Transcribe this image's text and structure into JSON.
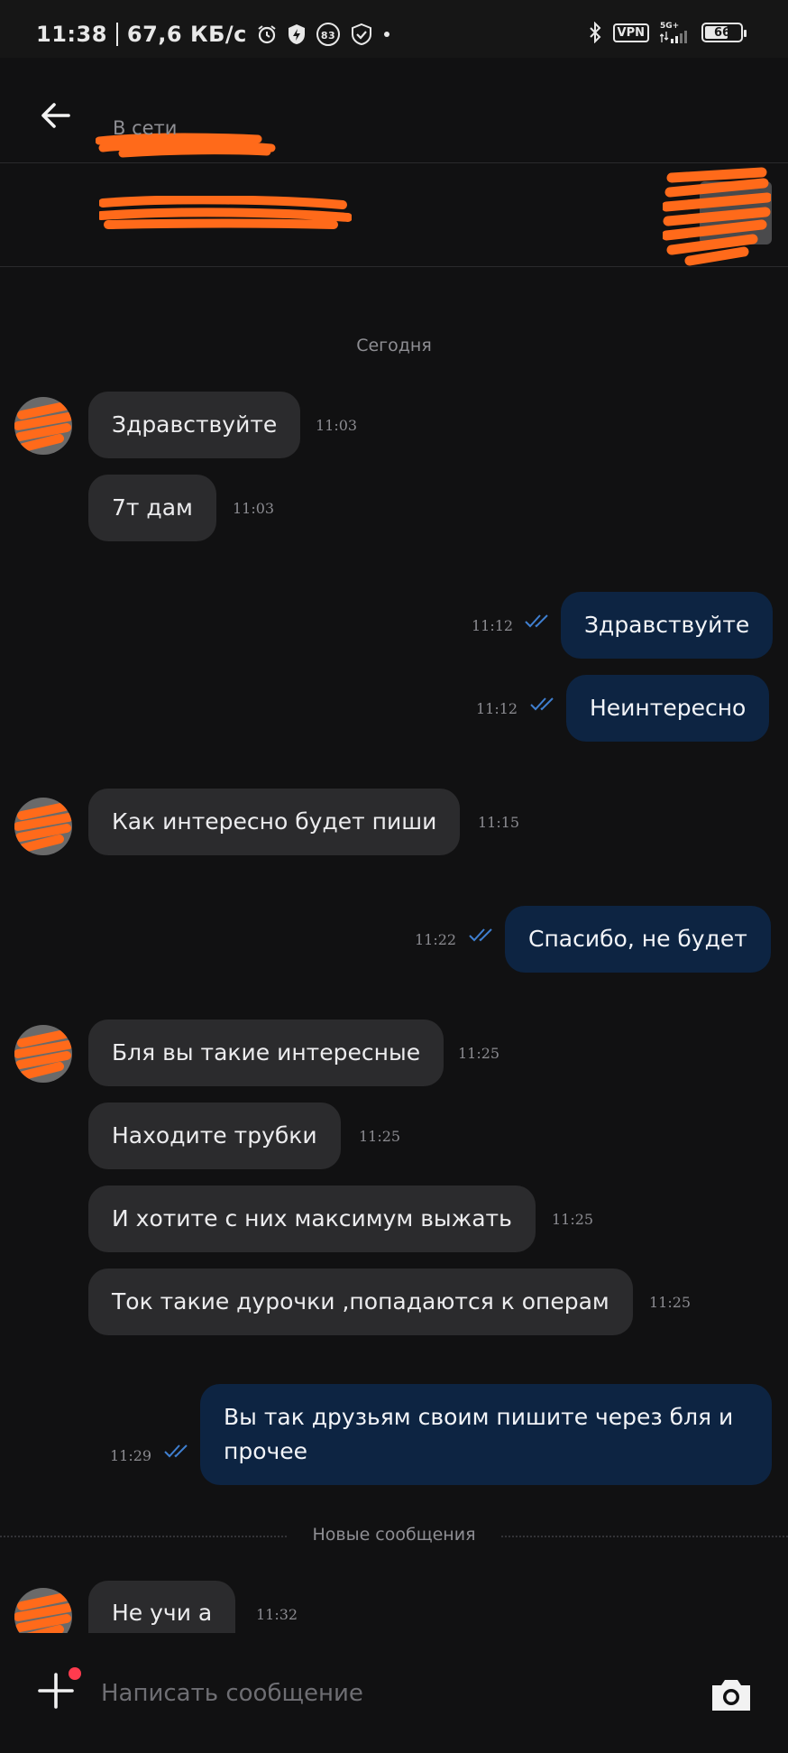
{
  "status_bar": {
    "time": "11:38",
    "net_speed": "67,6 КБ/с",
    "notif_badge": "83",
    "vpn": "VPN",
    "signal": "5G+",
    "battery": "66",
    "battery_level": 0.66
  },
  "header": {
    "status": "В сети"
  },
  "chat": {
    "day_label": "Сегодня",
    "new_messages_label": "Новые сообщения",
    "messages": [
      {
        "dir": "in",
        "text": "Здравствуйте",
        "time": "11:03"
      },
      {
        "dir": "in",
        "text": "7т дам",
        "time": "11:03"
      },
      {
        "dir": "out",
        "text": "Здравствуйте",
        "time": "11:12"
      },
      {
        "dir": "out",
        "text": "Неинтересно",
        "time": "11:12"
      },
      {
        "dir": "in",
        "text": "Как интересно будет пиши",
        "time": "11:15"
      },
      {
        "dir": "out",
        "text": "Спасибо, не будет",
        "time": "11:22"
      },
      {
        "dir": "in",
        "text": "Бля вы такие интересные",
        "time": "11:25"
      },
      {
        "dir": "in",
        "text": "Находите трубки",
        "time": "11:25"
      },
      {
        "dir": "in",
        "text": "И хотите с них максимум выжать",
        "time": "11:25"
      },
      {
        "dir": "in",
        "text": "Ток такие дурочки ,попадаются к операм",
        "time": "11:25"
      },
      {
        "dir": "out",
        "text": "Вы так друзьям своим пишите через бля и прочее",
        "time": "11:29"
      },
      {
        "dir": "in",
        "text": "Не учи а",
        "time": "11:32"
      }
    ]
  },
  "composer": {
    "placeholder": "Написать сообщение"
  },
  "colors": {
    "background": "#111112",
    "incoming_bubble": "#2b2b2d",
    "outgoing_bubble": "#0d2442",
    "read_check": "#3f7fd0",
    "redaction": "#ff6a1a",
    "attach_badge": "#ff3b4e"
  },
  "icons": [
    "back-arrow-icon",
    "plus-icon",
    "camera-icon",
    "double-check-icon",
    "alarm-icon",
    "shield-icon",
    "bluetooth-icon",
    "signal-icon",
    "battery-icon"
  ]
}
